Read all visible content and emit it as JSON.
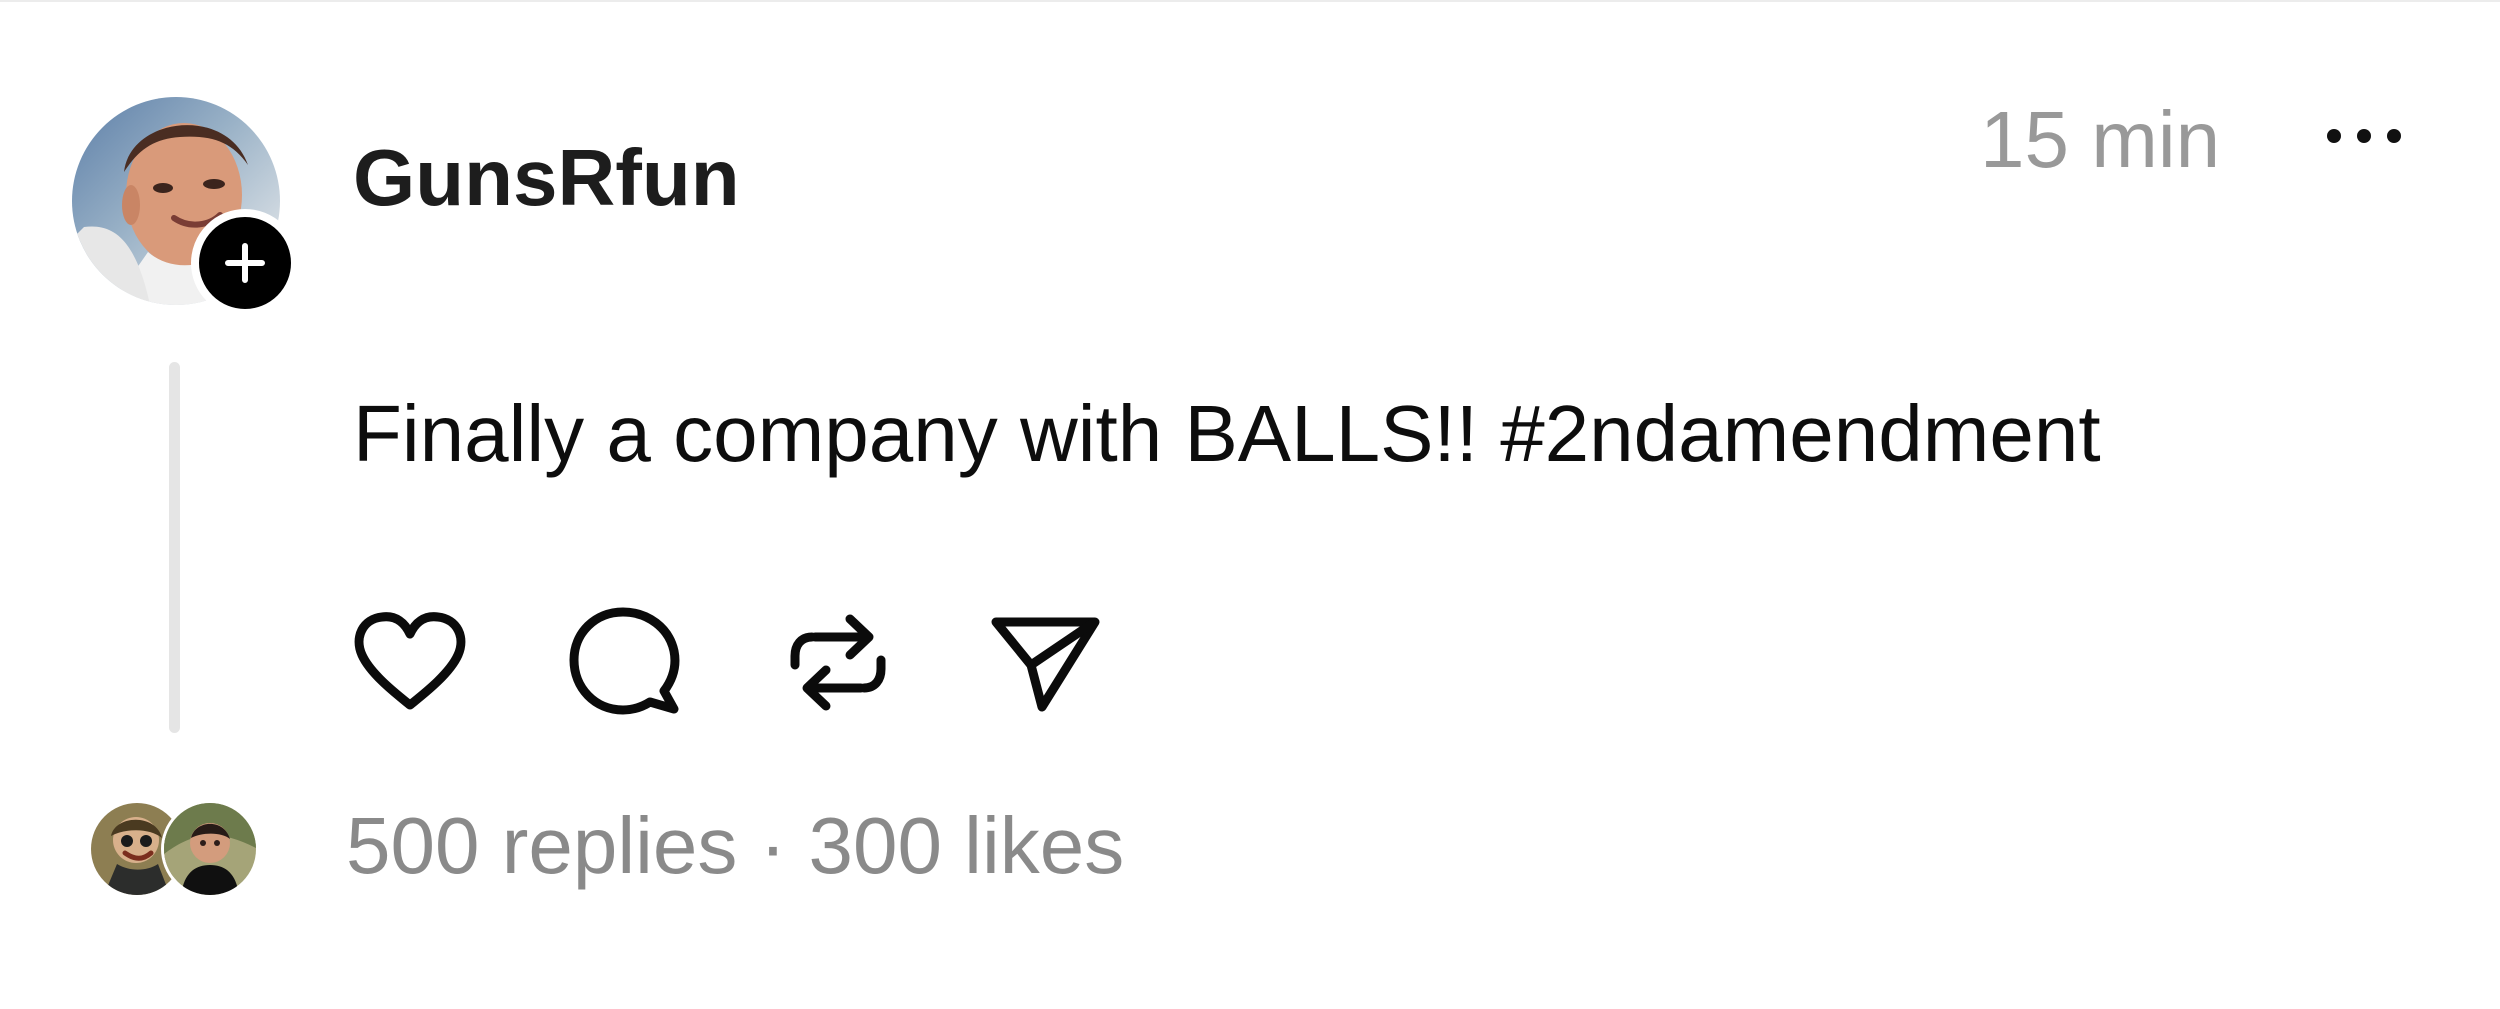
{
  "post": {
    "author": {
      "username": "GunsRfun",
      "avatar_icon": "user-avatar-photo",
      "follow_icon": "plus-icon"
    },
    "timestamp": "15 min",
    "more_icon": "more-horizontal-icon",
    "text": "Finally a company with BALLS!! #2ndamendment",
    "actions": [
      {
        "name": "like",
        "icon": "heart-icon"
      },
      {
        "name": "reply",
        "icon": "comment-bubble-icon"
      },
      {
        "name": "repost",
        "icon": "repost-icon"
      },
      {
        "name": "share",
        "icon": "send-icon"
      }
    ],
    "footer": {
      "replies": "500 replies",
      "separator": " · ",
      "likes": "300 likes"
    }
  },
  "colors": {
    "text_primary": "#1d1d1d",
    "text_secondary": "#999999",
    "thread_line": "#e5e5e5",
    "badge": "#000000"
  }
}
